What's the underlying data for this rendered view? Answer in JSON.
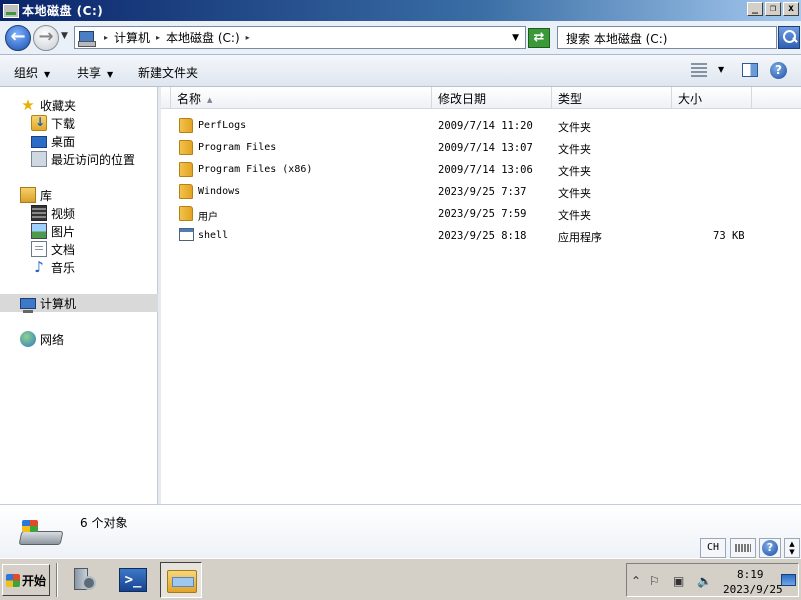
{
  "window": {
    "title": "本地磁盘 (C:)",
    "buttons": {
      "minimize": "_",
      "restore": "❐",
      "close": "x"
    }
  },
  "address": {
    "crumbs": [
      "计算机",
      "本地磁盘 (C:)"
    ],
    "search_placeholder": "搜索 本地磁盘 (C:)"
  },
  "toolbar": {
    "organize": "组织",
    "share": "共享",
    "new_folder": "新建文件夹"
  },
  "sidebar": {
    "favorites": {
      "label": "收藏夹",
      "items": [
        "下载",
        "桌面",
        "最近访问的位置"
      ]
    },
    "libraries": {
      "label": "库",
      "items": [
        "视频",
        "图片",
        "文档",
        "音乐"
      ]
    },
    "computer": "计算机",
    "network": "网络"
  },
  "columns": [
    "名称",
    "修改日期",
    "类型",
    "大小"
  ],
  "files": [
    {
      "name": "PerfLogs",
      "date": "2009/7/14 11:20",
      "type": "文件夹",
      "size": "",
      "icon": "folder-icon"
    },
    {
      "name": "Program Files",
      "date": "2009/7/14 13:07",
      "type": "文件夹",
      "size": "",
      "icon": "folder-icon"
    },
    {
      "name": "Program Files (x86)",
      "date": "2009/7/14 13:06",
      "type": "文件夹",
      "size": "",
      "icon": "folder-icon"
    },
    {
      "name": "Windows",
      "date": "2023/9/25 7:37",
      "type": "文件夹",
      "size": "",
      "icon": "folder-icon"
    },
    {
      "name": "用户",
      "date": "2023/9/25 7:59",
      "type": "文件夹",
      "size": "",
      "icon": "folder-icon"
    },
    {
      "name": "shell",
      "date": "2023/9/25 8:18",
      "type": "应用程序",
      "size": "73 KB",
      "icon": "application-icon"
    }
  ],
  "details": {
    "count": "6 个对象"
  },
  "lang_bar": {
    "language": "CH"
  },
  "taskbar": {
    "start": "开始",
    "time": "8:19",
    "date": "2023/9/25"
  }
}
